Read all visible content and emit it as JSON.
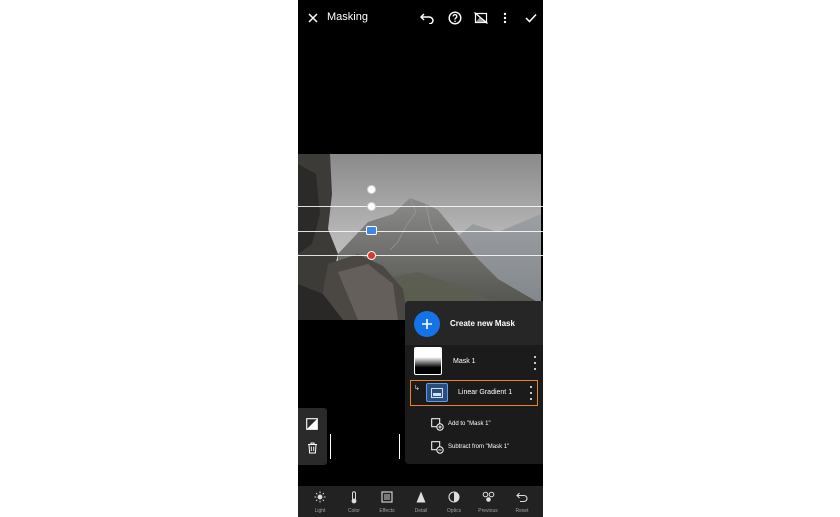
{
  "header": {
    "title": "Masking",
    "icons": [
      "close-icon",
      "undo-icon",
      "help-icon",
      "overlay-toggle-icon",
      "more-icon",
      "check-icon"
    ]
  },
  "panel": {
    "create_label": "Create new Mask",
    "mask_label": "Mask 1",
    "component_label": "Linear Gradient 1",
    "add_label": "Add to \"Mask 1\"",
    "subtract_label": "Subtract from \"Mask 1\""
  },
  "toolbar": {
    "items": [
      {
        "label": "Light",
        "icon": "light-icon"
      },
      {
        "label": "Color",
        "icon": "color-icon"
      },
      {
        "label": "Effects",
        "icon": "effects-icon"
      },
      {
        "label": "Detail",
        "icon": "detail-icon"
      },
      {
        "label": "Optics",
        "icon": "optics-icon"
      },
      {
        "label": "Previous",
        "icon": "previous-icon"
      },
      {
        "label": "Reset",
        "icon": "reset-icon"
      }
    ]
  },
  "colors": {
    "accent_blue": "#1473e6",
    "selection_orange": "#e8832a",
    "pin_red": "#d63a33"
  }
}
